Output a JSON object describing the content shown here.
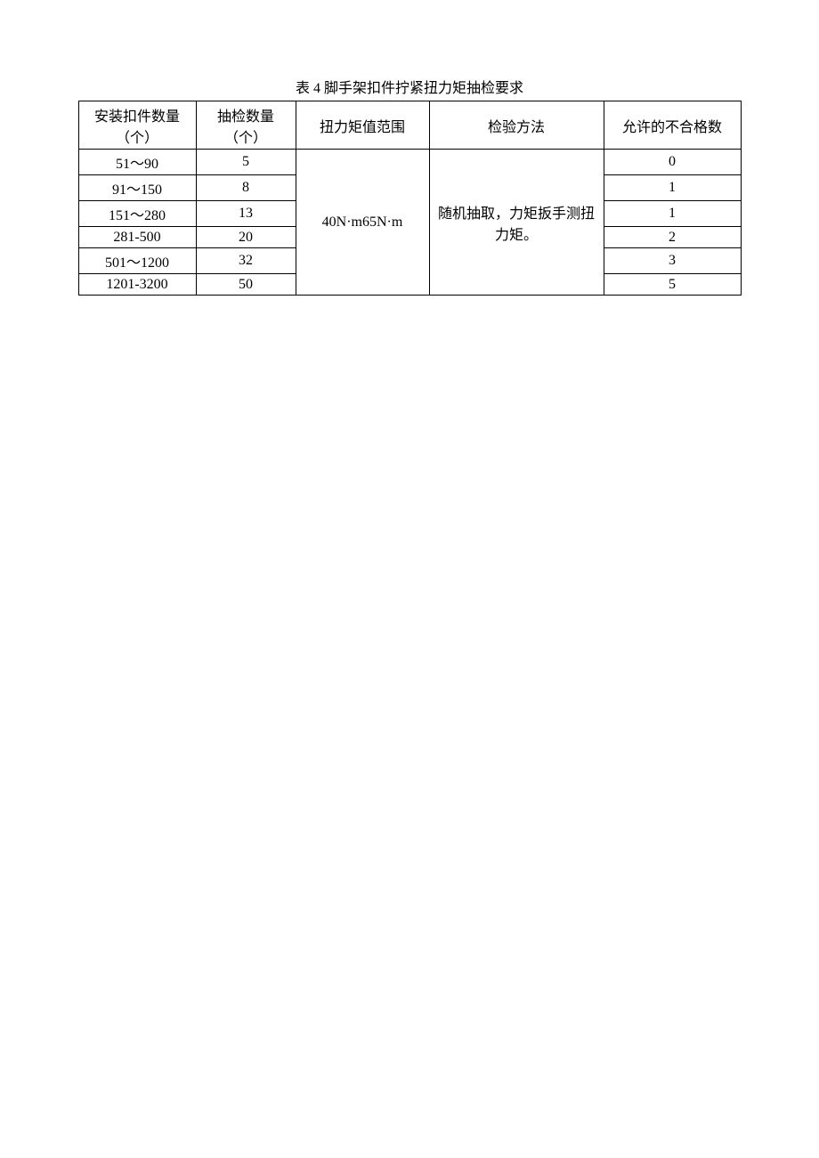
{
  "title": "表 4 脚手架扣件拧紧扭力矩抽检要求",
  "headers": {
    "col1": "安装扣件数量（个）",
    "col2": "抽检数量（个）",
    "col3": "扭力矩值范围",
    "col4": "检验方法",
    "col5": "允许的不合格数"
  },
  "torque_range": "40N·m65N·m",
  "inspection_method": "随机抽取，力矩扳手测扭力矩。",
  "rows": [
    {
      "qty_range": "51～90",
      "sample": "5",
      "allowed": "0"
    },
    {
      "qty_range": "91～150",
      "sample": "8",
      "allowed": "1"
    },
    {
      "qty_range": "151～280",
      "sample": "13",
      "allowed": "1"
    },
    {
      "qty_range": "281-500",
      "sample": "20",
      "allowed": "2"
    },
    {
      "qty_range": "501～1200",
      "sample": "32",
      "allowed": "3"
    },
    {
      "qty_range": "1201-3200",
      "sample": "50",
      "allowed": "5"
    }
  ]
}
